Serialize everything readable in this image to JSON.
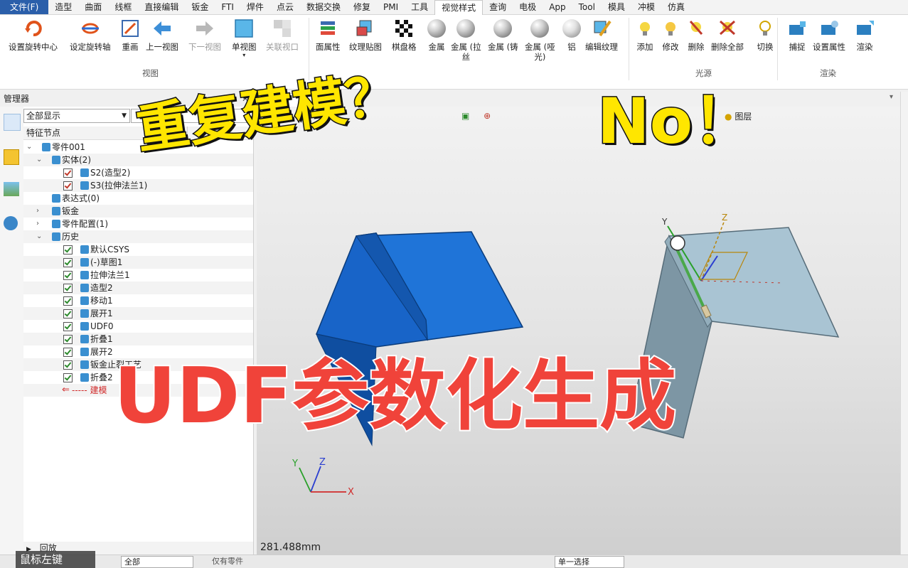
{
  "menu": {
    "items": [
      "文件(F)",
      "造型",
      "曲面",
      "线框",
      "直接编辑",
      "钣金",
      "FTI",
      "焊件",
      "点云",
      "数据交换",
      "修复",
      "PMI",
      "工具",
      "视觉样式",
      "查询",
      "电极",
      "App",
      "Tool",
      "模具",
      "冲模",
      "仿真"
    ],
    "active": "视觉样式"
  },
  "ribbon": {
    "view_buttons": [
      "设置旋转中心",
      "设定旋转轴",
      "重画",
      "上一视图",
      "下一视图",
      "单视图",
      "关联视口"
    ],
    "view_group_label": "视图",
    "style_buttons": [
      "面属性",
      "纹理贴图",
      "棋盘格",
      "金属",
      "金属 (拉",
      "金属 (铸",
      "金属 (哑",
      "铝",
      "编辑纹理"
    ],
    "style_sublabels": [
      "丝",
      "光)"
    ],
    "light_buttons": [
      "添加",
      "修改",
      "删除",
      "删除全部",
      "切换"
    ],
    "light_group_label": "光源",
    "render_buttons": [
      "捕捉",
      "设置属性",
      "渲染"
    ],
    "render_group_label": "渲染"
  },
  "manager": {
    "title": "管理器",
    "filter": "全部显示",
    "column_header": "特征节点",
    "rows": [
      {
        "label": "零件001",
        "indent": 0,
        "expander": "v",
        "check": ""
      },
      {
        "label": "实体(2)",
        "indent": 1,
        "expander": "v",
        "check": ""
      },
      {
        "label": "S2(造型2)",
        "indent": 2,
        "expander": "",
        "check": "red"
      },
      {
        "label": "S3(拉伸法兰1)",
        "indent": 2,
        "expander": "",
        "check": "red"
      },
      {
        "label": "表达式(0)",
        "indent": 1,
        "expander": "",
        "check": ""
      },
      {
        "label": "钣金",
        "indent": 1,
        "expander": ">",
        "check": ""
      },
      {
        "label": "零件配置(1)",
        "indent": 1,
        "expander": ">",
        "check": ""
      },
      {
        "label": "历史",
        "indent": 1,
        "expander": "v",
        "check": ""
      },
      {
        "label": "默认CSYS",
        "indent": 2,
        "expander": "",
        "check": "green"
      },
      {
        "label": "(-)草图1",
        "indent": 2,
        "expander": "",
        "check": "green"
      },
      {
        "label": "拉伸法兰1",
        "indent": 2,
        "expander": "",
        "check": "green"
      },
      {
        "label": "造型2",
        "indent": 2,
        "expander": "",
        "check": "green"
      },
      {
        "label": "移动1",
        "indent": 2,
        "expander": "",
        "check": "green"
      },
      {
        "label": "展开1",
        "indent": 2,
        "expander": "",
        "check": "green"
      },
      {
        "label": "UDF0",
        "indent": 2,
        "expander": "",
        "check": "green"
      },
      {
        "label": "折叠1",
        "indent": 2,
        "expander": "",
        "check": "green"
      },
      {
        "label": "展开2",
        "indent": 2,
        "expander": "",
        "check": "green"
      },
      {
        "label": "钣金止裂工艺",
        "indent": 2,
        "expander": "",
        "check": "green"
      },
      {
        "label": "折叠2",
        "indent": 2,
        "expander": "",
        "check": "green"
      },
      {
        "label": "----- 建模",
        "indent": 2,
        "expander": "",
        "check": "marker"
      }
    ],
    "footer": "回放"
  },
  "viewport": {
    "measure": "281.488mm",
    "layer_label": "图层",
    "axis_labels": {
      "x": "X",
      "y": "Y",
      "z": "Z"
    }
  },
  "bottom": {
    "caption": "鼠标左键",
    "filter_all": "全部",
    "filter_parts": "仅有零件",
    "select_mode": "单一选择"
  },
  "overlays": {
    "title_a": "重复建模？",
    "title_b": "No！",
    "subtitle": "UDF参数化生成"
  },
  "colors": {
    "accent": "#2b5faa",
    "solid_blue": "#1565c0",
    "plate_gray": "#8fa9b8",
    "overlay_yellow": "#ffe600",
    "overlay_red": "#f0433a"
  }
}
